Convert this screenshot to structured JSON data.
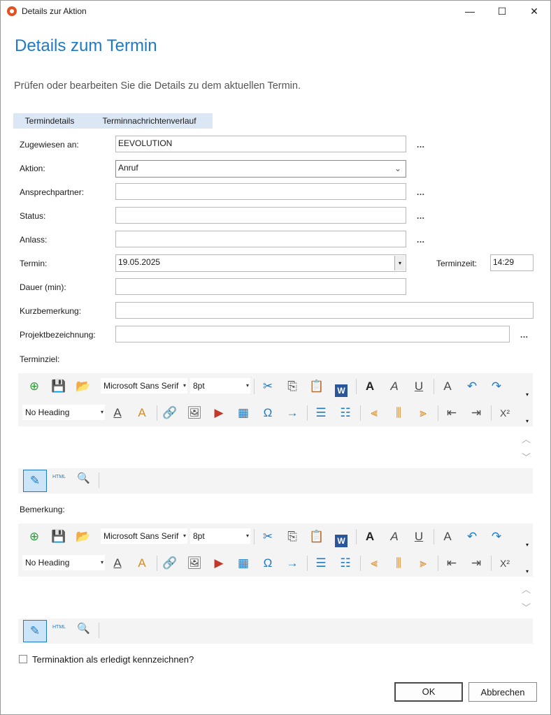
{
  "window": {
    "title": "Details zur Aktion",
    "min_glyph": "—",
    "max_glyph": "☐",
    "close_glyph": "✕"
  },
  "page": {
    "heading": "Details zum Termin",
    "subtitle": "Prüfen oder bearbeiten Sie die Details zu dem aktuellen Termin."
  },
  "tabs": [
    "Termindetails",
    "Terminnachrichtenverlauf"
  ],
  "form": {
    "zugewiesen_label": "Zugewiesen an:",
    "zugewiesen_value": "EEVOLUTION",
    "aktion_label": "Aktion:",
    "aktion_value": "Anruf",
    "ansprech_label": "Ansprechpartner:",
    "ansprech_value": "",
    "status_label": "Status:",
    "status_value": "",
    "anlass_label": "Anlass:",
    "anlass_value": "",
    "termin_label": "Termin:",
    "termin_value": "19.05.2025",
    "terminzeit_label": "Terminzeit:",
    "terminzeit_value": "14:29",
    "dauer_label": "Dauer (min):",
    "dauer_value": "",
    "kurz_label": "Kurzbemerkung:",
    "kurz_value": "",
    "projekt_label": "Projektbezeichnung:",
    "projekt_value": "",
    "ellipsis": "..."
  },
  "editor_terminziel": {
    "label": "Terminziel:",
    "font": "Microsoft Sans Serif",
    "size": "8pt",
    "heading": "No Heading",
    "html_label": "HTML"
  },
  "editor_bemerkung": {
    "label": "Bemerkung:",
    "font": "Microsoft Sans Serif",
    "size": "8pt",
    "heading": "No Heading",
    "html_label": "HTML"
  },
  "icons": {
    "add": "⊕",
    "save": "💾",
    "open": "📂",
    "cut": "✂",
    "copy": "⎘",
    "paste": "📋",
    "word": "W",
    "bold": "A",
    "italic": "A",
    "underline": "U",
    "font_color": "A",
    "undo": "↶",
    "redo": "↷",
    "text_color": "A",
    "highlight": "A",
    "link": "🔗",
    "image": "🖼",
    "media": "▶",
    "table": "▦",
    "symbol": "Ω",
    "arrow": "→",
    "bullets": "☰",
    "numbers": "☷",
    "align_left": "⫷",
    "align_center": "⫼",
    "align_right": "⫸",
    "outdent": "⇤",
    "indent": "⇥",
    "superscript": "X²",
    "edit": "✎",
    "preview": "🔍",
    "scroll_up": "︿",
    "scroll_down": "﹀",
    "dropdown": "▾"
  },
  "checkbox": {
    "label": "Terminaktion als erledigt kennzeichnen?",
    "checked": false
  },
  "buttons": {
    "ok": "OK",
    "cancel": "Abbrechen"
  }
}
